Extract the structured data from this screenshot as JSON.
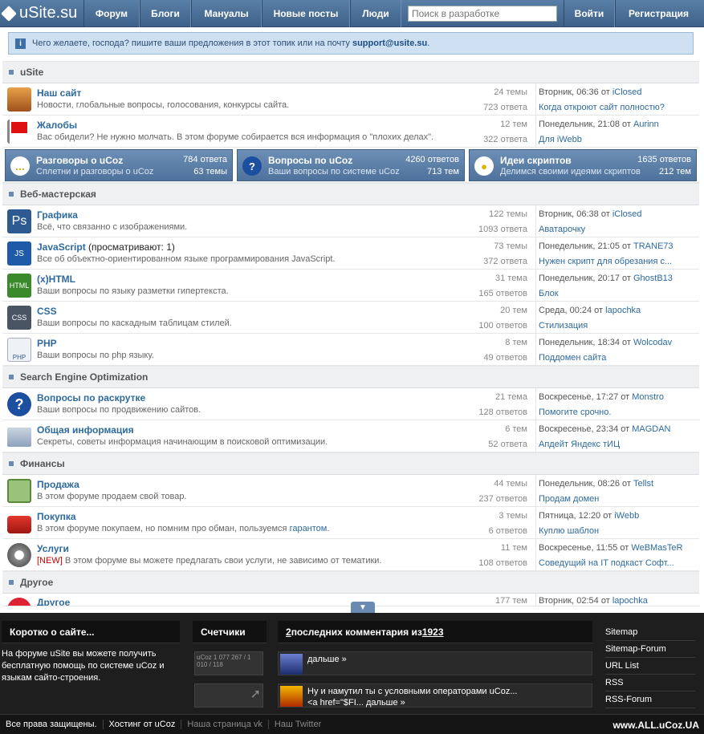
{
  "header": {
    "logo": "uSite.su",
    "nav": [
      "Форум",
      "Блоги",
      "Мануалы",
      "Новые посты",
      "Люди"
    ],
    "search_placeholder": "Поиск в разработке",
    "login": "Войти",
    "register": "Регистрация"
  },
  "notice": {
    "text": "Чего желаете, господа? пишите ваши предложения в этот топик или на почту ",
    "email": "support@usite.su",
    "tail": "."
  },
  "categories": {
    "usite": "uSite",
    "web": "Веб-мастерская",
    "seo": "Search Engine Optimization",
    "fin": "Финансы",
    "other": "Другое"
  },
  "forums": {
    "nash": {
      "title": "Наш сайт",
      "desc": "Новости, глобальные вопросы, голосования, конкурсы сайта.",
      "topics": "24 темы",
      "answers": "723 ответа",
      "time": "Вторник, 06:36 от ",
      "who": "iClosed",
      "topic": "Когда откроют сайт полностю?"
    },
    "zhal": {
      "title": "Жалобы",
      "desc": "Вас обидели? Не нужно молчать. В этом форуме собирается вся информация о \"плохих делах\".",
      "topics": "12 тем",
      "answers": "322 ответа",
      "time": "Понедельник, 21:08 от ",
      "who": "Aurinn",
      "topic": "Для iWebb"
    },
    "graf": {
      "title": "Графика",
      "desc": "Всё, что связанно с изображениями.",
      "topics": "122 темы",
      "answers": "1093 ответа",
      "time": "Вторник, 06:38 от ",
      "who": "iClosed",
      "topic": "Аватарочку"
    },
    "js": {
      "title": "JavaScript",
      "extra": " (просматривают: 1)",
      "desc": "Все об объектно-ориентированном языке программирования JavaScript.",
      "topics": "73 темы",
      "answers": "372 ответа",
      "time": "Понедельник, 21:05 от ",
      "who": "TRANE73",
      "topic": "Нужен скрипт для обрезания с..."
    },
    "html": {
      "title": "(x)HTML",
      "desc": "Ваши вопросы по языку разметки гипертекста.",
      "topics": "31 тема",
      "answers": "165 ответов",
      "time": "Понедельник, 20:17 от ",
      "who": "GhostB13",
      "topic": "Блок"
    },
    "css": {
      "title": "CSS",
      "desc": "Ваши вопросы по каскадным таблицам стилей.",
      "topics": "20 тем",
      "answers": "100 ответов",
      "time": "Среда, 00:24 от ",
      "who": "lapochka",
      "topic": "Стилизация"
    },
    "php": {
      "title": "PHP",
      "desc": "Ваши вопросы по php языку.",
      "topics": "8 тем",
      "answers": "49 ответов",
      "time": "Понедельник, 18:34 от ",
      "who": "Wolcodav",
      "topic": "Поддомен сайта"
    },
    "rask": {
      "title": "Вопросы по раскрутке",
      "desc": "Ваши вопросы по продвижению сайтов.",
      "topics": "21 тема",
      "answers": "128 ответов",
      "time": "Воскресенье, 17:27 от ",
      "who": "Monstro",
      "topic": "Помогите срочно."
    },
    "info": {
      "title": "Общая информация",
      "desc": "Секреты, советы информация начинающим в поисковой оптимизации.",
      "topics": "6 тем",
      "answers": "52 ответа",
      "time": "Воскресенье, 23:34 от ",
      "who": "MAGDAN",
      "topic": "Апдейт Яндекс тИЦ"
    },
    "prod": {
      "title": "Продажа",
      "desc": "В этом форуме продаем свой товар.",
      "topics": "44 темы",
      "answers": "237 ответов",
      "time": "Понедельник, 08:26 от ",
      "who": "Tellst",
      "topic": "Продам домен"
    },
    "pok": {
      "title": "Покупка",
      "desc": "В этом форуме покупаем, но помним про обман, пользуемся ",
      "desc_link": "гарантом",
      "desc_tail": ".",
      "topics": "3 темы",
      "answers": "6 ответов",
      "time": "Пятница, 12:20 от ",
      "who": "iWebb",
      "topic": "Куплю шаблон"
    },
    "usl": {
      "title": "Услуги",
      "new": "[NEW]",
      "desc": " В этом форуме вы можете предлагать свои услуги, не зависимо от тематики.",
      "topics": "11 тем",
      "answers": "108 ответов",
      "time": "Воскресенье, 11:55 от ",
      "who": "WeBMasTeR",
      "topic": "Соведущий на IT подкаст Софт..."
    },
    "drug": {
      "title": "Другое",
      "topics": "177 тем",
      "time": "Вторник, 02:54 от ",
      "who": "lapochka"
    }
  },
  "tiles": [
    {
      "title": "Разговоры о uCoz",
      "desc": "Сплетни и разговоры о uCoz",
      "answers": "784 ответа",
      "topics": "63 темы"
    },
    {
      "title": "Вопросы по uCoz",
      "desc": "Ваши вопросы по системе uCoz",
      "answers": "4260 ответов",
      "topics": "713 тем"
    },
    {
      "title": "Идеи скриптов",
      "desc": "Делимся своими идеями скриптов",
      "answers": "1635 ответов",
      "topics": "212 тем"
    }
  ],
  "footer": {
    "about_title": "Коротко о сайте...",
    "about_text": "На форуме uSite вы можете получить бесплатную помощь по системе uCoz и языкам сайто-строения.",
    "counters_title": "Счетчики",
    "counter1": "uCoz 1 077 267 / 1 010 / 118",
    "comments_count": "2",
    "comments_mid": " последних комментария из ",
    "comments_total": "1923",
    "comment1": "дальше »",
    "comment2a": "Ну и намутил ты с условными операторами uCoz...",
    "comment2b": "<a href=\"$FI... дальше »",
    "links": [
      "Sitemap",
      "Sitemap-Forum",
      "URL List",
      "RSS",
      "RSS-Forum"
    ],
    "bottom": [
      "Все права защищены.",
      "Хостинг от uCoz",
      "Наша страница vk",
      "Наш Twitter"
    ],
    "watermark": "www.ALL.uCoz.UA"
  }
}
